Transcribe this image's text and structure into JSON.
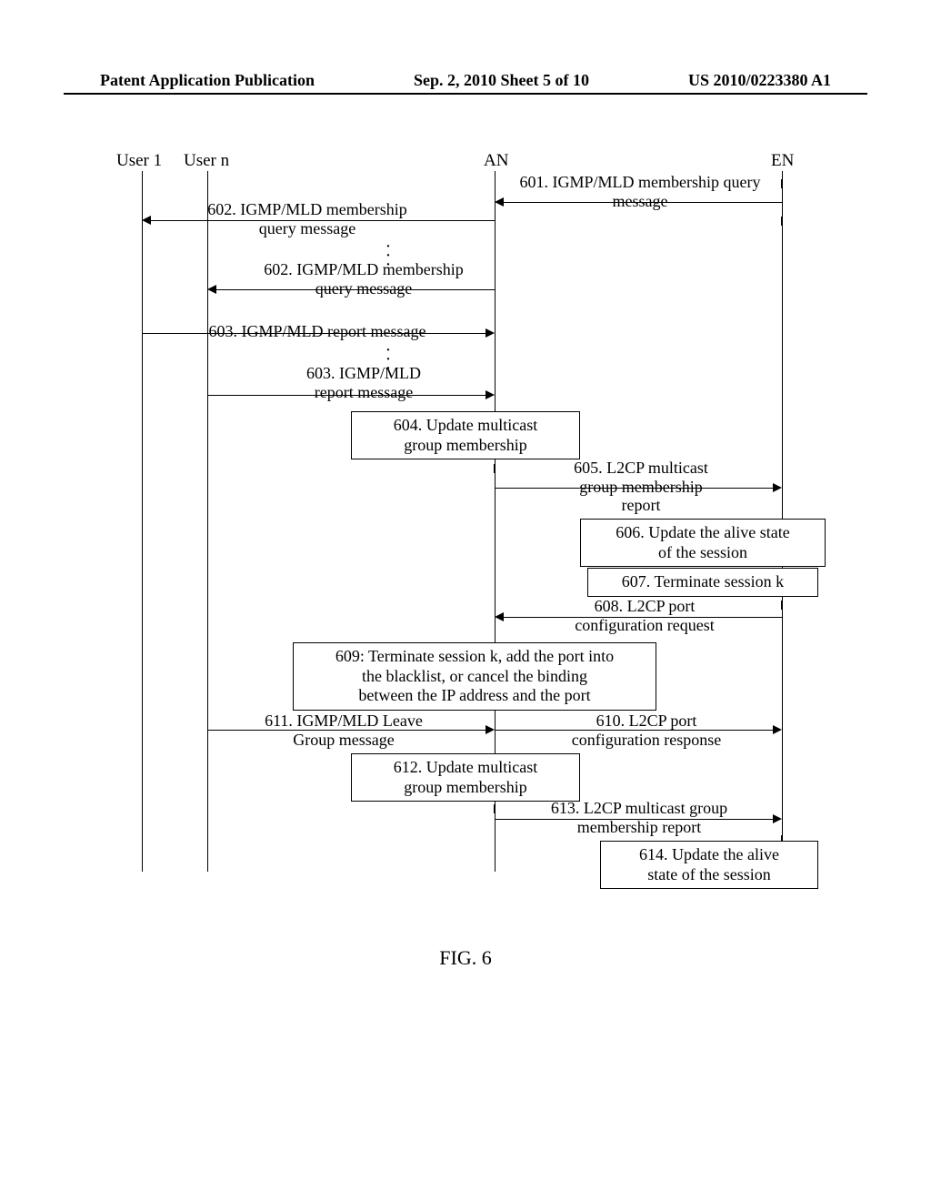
{
  "header": {
    "left": "Patent Application Publication",
    "center": "Sep. 2, 2010   Sheet 5 of 10",
    "right": "US 2010/0223380 A1"
  },
  "actors": {
    "user1": "User 1",
    "usern": "User n",
    "an": "AN",
    "en": "EN"
  },
  "messages": {
    "m601": "601. IGMP/MLD membership query message",
    "m602a": "602. IGMP/MLD membership query message",
    "m602b": "602. IGMP/MLD membership query message",
    "m603a": "603. IGMP/MLD report message",
    "m603b": "603. IGMP/MLD report message",
    "m604": "604. Update multicast group membership",
    "m605": "605. L2CP multicast group membership report",
    "m606": "606. Update the alive state of the session",
    "m607": "607. Terminate session k",
    "m608": "608. L2CP port configuration request",
    "m609": "609: Terminate session k, add the port into the blacklist, or cancel the binding between the IP address and the port",
    "m610": "610. L2CP port configuration response",
    "m611": "611. IGMP/MLD Leave Group message",
    "m612": "612. Update multicast group membership",
    "m613": "613. L2CP multicast group membership report",
    "m614": "614. Update the alive state of the session"
  },
  "figure": "FIG. 6"
}
